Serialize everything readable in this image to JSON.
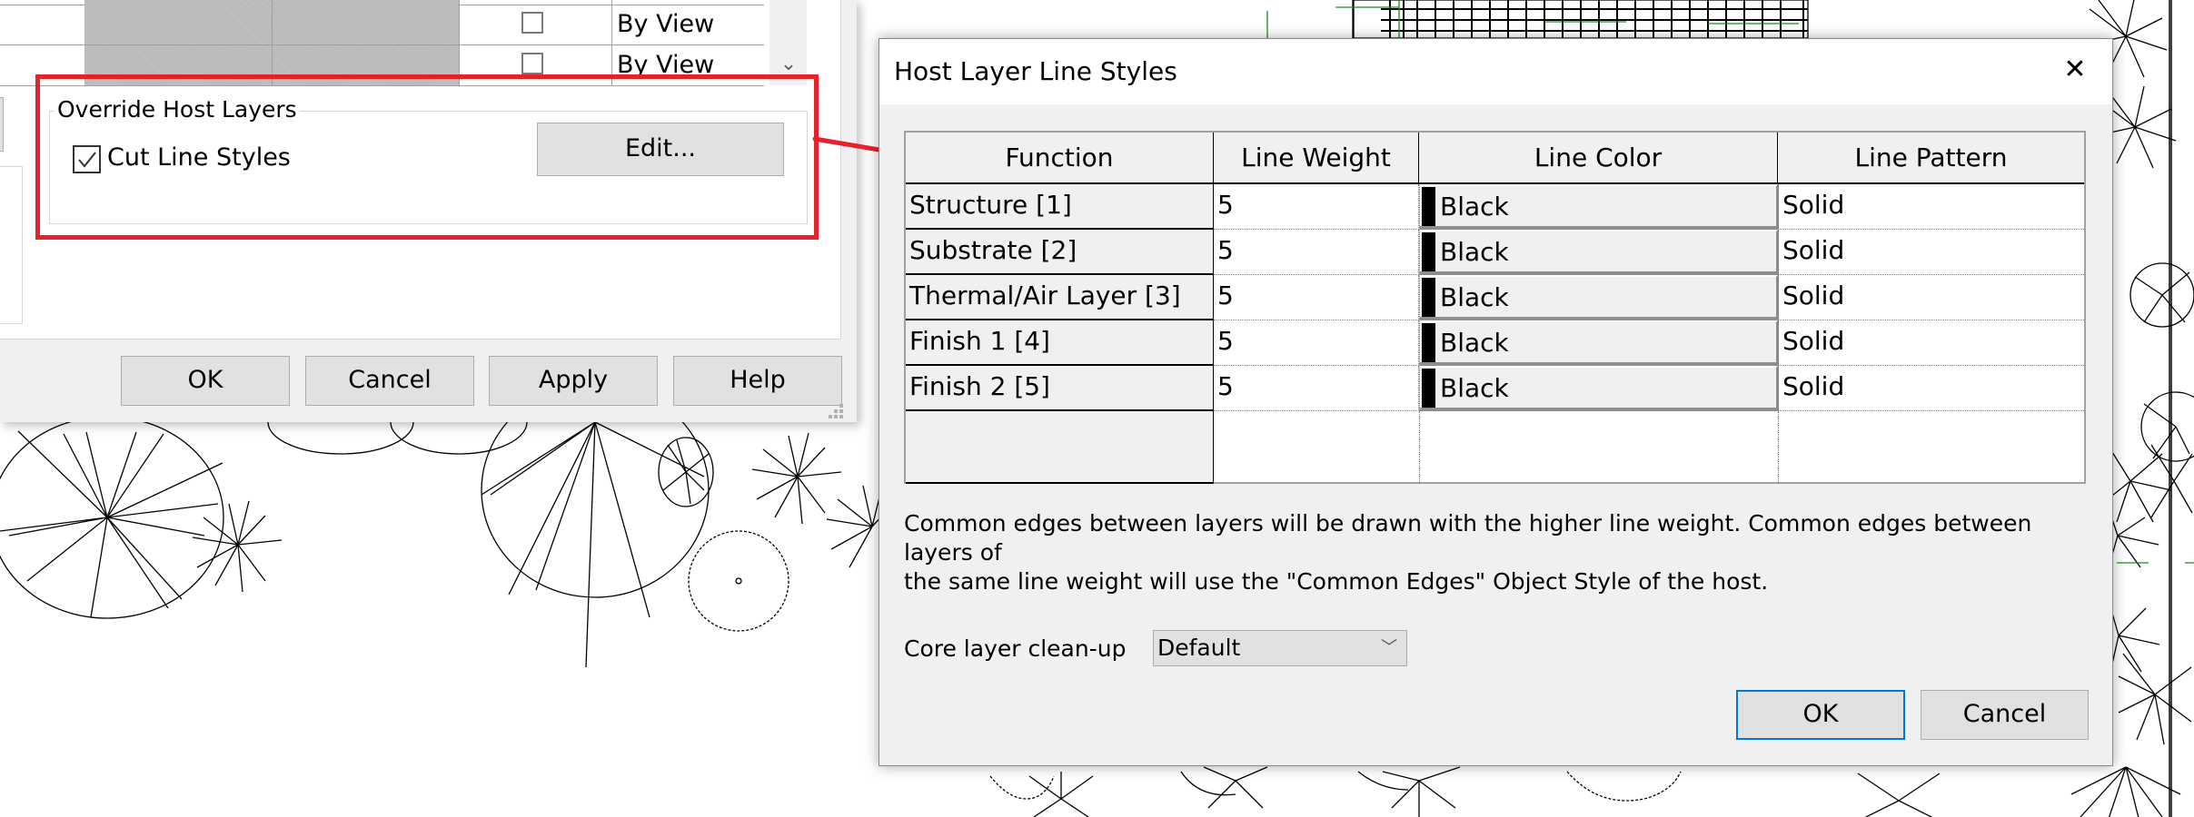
{
  "background_dialog": {
    "table_rows": [
      {
        "checked": false,
        "value": "By View"
      },
      {
        "checked": false,
        "value": "By View"
      }
    ],
    "group": {
      "title": "Override Host Layers",
      "checkbox_label": "Cut Line Styles",
      "checkbox_checked": true,
      "edit_button": "Edit..."
    },
    "buttons": {
      "ok": "OK",
      "cancel": "Cancel",
      "apply": "Apply",
      "help": "Help"
    }
  },
  "annotation": {
    "color": "#e8202a"
  },
  "host_dialog": {
    "title": "Host Layer Line Styles",
    "close_icon": "close-icon",
    "table": {
      "headers": [
        "Function",
        "Line Weight",
        "Line Color",
        "Line Pattern"
      ],
      "rows": [
        {
          "function": "Structure [1]",
          "line_weight": "5",
          "line_color": "Black",
          "color_hex": "#000000",
          "line_pattern": "Solid"
        },
        {
          "function": "Substrate [2]",
          "line_weight": "5",
          "line_color": "Black",
          "color_hex": "#000000",
          "line_pattern": "Solid"
        },
        {
          "function": "Thermal/Air Layer [3]",
          "line_weight": "5",
          "line_color": "Black",
          "color_hex": "#000000",
          "line_pattern": "Solid"
        },
        {
          "function": "Finish 1 [4]",
          "line_weight": "5",
          "line_color": "Black",
          "color_hex": "#000000",
          "line_pattern": "Solid"
        },
        {
          "function": "Finish 2 [5]",
          "line_weight": "5",
          "line_color": "Black",
          "color_hex": "#000000",
          "line_pattern": "Solid"
        }
      ]
    },
    "note_line1": "Common edges between layers will be drawn with the higher line weight.  Common edges between layers of",
    "note_line2": "the same line weight will use the \"Common Edges\" Object Style of the host.",
    "core_cleanup_label": "Core layer clean-up",
    "core_cleanup_value": "Default",
    "ok_button": "OK",
    "cancel_button": "Cancel",
    "accent_color": "#0078d7"
  }
}
